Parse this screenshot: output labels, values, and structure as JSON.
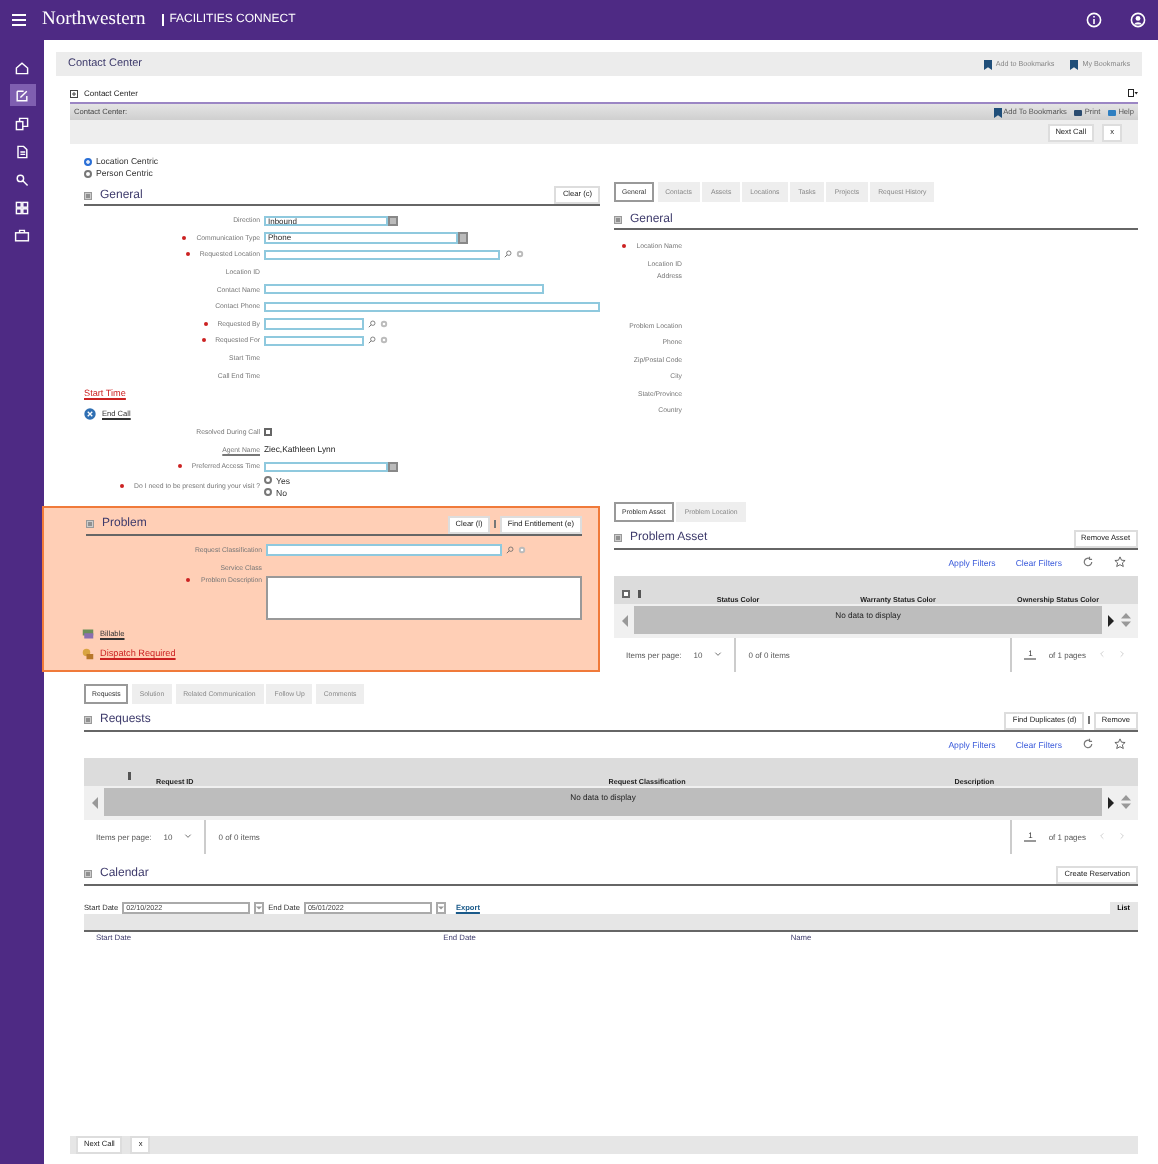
{
  "app_bar": {
    "brand": "Northwestern",
    "product": "FACILITIES CONNECT"
  },
  "sidebar": {
    "items": [
      {
        "selected": false
      },
      {
        "selected": true
      },
      {
        "selected": false
      },
      {
        "selected": false
      },
      {
        "selected": false
      },
      {
        "selected": false
      },
      {
        "selected": false
      }
    ]
  },
  "page_header": {
    "title": "Contact Center",
    "actions": [
      "Add to Bookmarks",
      "My Bookmarks"
    ]
  },
  "panel": {
    "title": "Contact Center",
    "toolbar_title": "Contact Center:",
    "toolbar_actions": [
      "Add To Bookmarks",
      "Print",
      "Help"
    ],
    "buttons": [
      "Next Call",
      "x"
    ]
  },
  "mode_options": [
    {
      "label": "Location Centric",
      "selected": true
    },
    {
      "label": "Person Centric",
      "selected": false
    }
  ],
  "general": {
    "title": "General",
    "actions": [
      "Clear (c)"
    ],
    "fields": [
      {
        "label": "Direction",
        "required": false,
        "kind": "select",
        "value": "Inbound"
      },
      {
        "label": "Communication Type",
        "required": true,
        "kind": "select",
        "value": "Phone"
      },
      {
        "label": "Requested Location",
        "required": true,
        "kind": "lookup"
      },
      {
        "label": "Location ID",
        "required": false,
        "kind": "static"
      },
      {
        "label": "Contact Name",
        "required": false,
        "kind": "text"
      },
      {
        "label": "Contact Phone",
        "required": false,
        "kind": "text"
      },
      {
        "label": "Requested By",
        "required": true,
        "kind": "lookup"
      },
      {
        "label": "Requested For",
        "required": true,
        "kind": "lookup"
      },
      {
        "label": "Start Time",
        "required": false,
        "kind": "static"
      },
      {
        "label": "Call End Time",
        "required": false,
        "kind": "static"
      },
      {
        "label": "Start Time",
        "kind": "link"
      },
      {
        "label": "End Call",
        "kind": "action"
      },
      {
        "label": "Resolved During Call",
        "required": false,
        "kind": "checkbox",
        "checked": false
      },
      {
        "label": "Agent Name",
        "required": false,
        "kind": "value",
        "value": "Ziec,Kathleen Lynn"
      },
      {
        "label": "Preferred Access Time",
        "required": true,
        "kind": "select"
      },
      {
        "label": "Do I need to be present during your visit ?",
        "required": true,
        "kind": "radio",
        "options": [
          {
            "label": "Yes",
            "selected": false
          },
          {
            "label": "No",
            "selected": false
          }
        ]
      }
    ]
  },
  "location_panel": {
    "tabs": [
      {
        "label": "General",
        "selected": true
      },
      {
        "label": "Contacts",
        "selected": false
      },
      {
        "label": "Assets",
        "selected": false
      },
      {
        "label": "Locations",
        "selected": false
      },
      {
        "label": "Tasks",
        "selected": false
      },
      {
        "label": "Projects",
        "selected": false
      },
      {
        "label": "Request History",
        "selected": false
      }
    ],
    "title": "General",
    "fields": [
      {
        "label": "Location Name",
        "required": true
      },
      {
        "label": "Location ID",
        "required": false
      },
      {
        "label": "Address",
        "required": false
      },
      {
        "label": "Problem Location",
        "required": false
      },
      {
        "label": "Phone",
        "required": false
      },
      {
        "label": "Zip/Postal Code",
        "required": false
      },
      {
        "label": "City",
        "required": false
      },
      {
        "label": "State/Province",
        "required": false
      },
      {
        "label": "Country",
        "required": false
      }
    ]
  },
  "problem": {
    "title": "Problem",
    "actions": [
      "Clear (l)",
      "Find Entitlement (e)"
    ],
    "fields": [
      {
        "label": "Request Classification",
        "required": false,
        "kind": "lookup"
      },
      {
        "label": "Service Class",
        "required": false,
        "kind": "static"
      },
      {
        "label": "Problem Description",
        "required": true,
        "kind": "textarea"
      }
    ],
    "links": [
      {
        "label": "Billable",
        "kind": "plain"
      },
      {
        "label": "Dispatch Required",
        "kind": "alert"
      }
    ]
  },
  "problem_asset": {
    "tabs": [
      {
        "label": "Problem Asset",
        "selected": true
      },
      {
        "label": "Problem Location",
        "selected": false
      }
    ],
    "title": "Problem Asset",
    "actions": [
      "Remove Asset"
    ],
    "filters": [
      "Apply Filters",
      "Clear Filters"
    ],
    "select_all": {
      "checked": false
    },
    "columns": [
      "Status Color",
      "Warranty Status Color",
      "Ownership Status Color"
    ],
    "empty_message": "No data to display",
    "pager": {
      "label": "Items per page:",
      "page_size": "10",
      "count": "0 of 0 items",
      "page": "1",
      "pages": "of 1 pages"
    }
  },
  "requests": {
    "tabs": [
      {
        "label": "Requests",
        "selected": true
      },
      {
        "label": "Solution",
        "selected": false
      },
      {
        "label": "Related Communication",
        "selected": false
      },
      {
        "label": "Follow Up",
        "selected": false
      },
      {
        "label": "Comments",
        "selected": false
      }
    ],
    "title": "Requests",
    "actions": [
      "Find Duplicates (d)",
      "Remove"
    ],
    "filters": [
      "Apply Filters",
      "Clear Filters"
    ],
    "columns": [
      "Request ID",
      "Request Classification",
      "Description"
    ],
    "empty_message": "No data to display",
    "pager": {
      "label": "Items per page:",
      "page_size": "10",
      "count": "0 of 0 items",
      "page": "1",
      "pages": "of 1 pages"
    }
  },
  "calendar": {
    "title": "Calendar",
    "actions": [
      "Create Reservation"
    ],
    "start_label": "Start Date",
    "start_value": "02/10/2022",
    "end_label": "End Date",
    "end_value": "05/01/2022",
    "export": "Export",
    "view_button": "List",
    "columns": [
      "Start Date",
      "End Date",
      "Name"
    ]
  },
  "footer": {
    "buttons": [
      "Next Call",
      "x"
    ]
  }
}
